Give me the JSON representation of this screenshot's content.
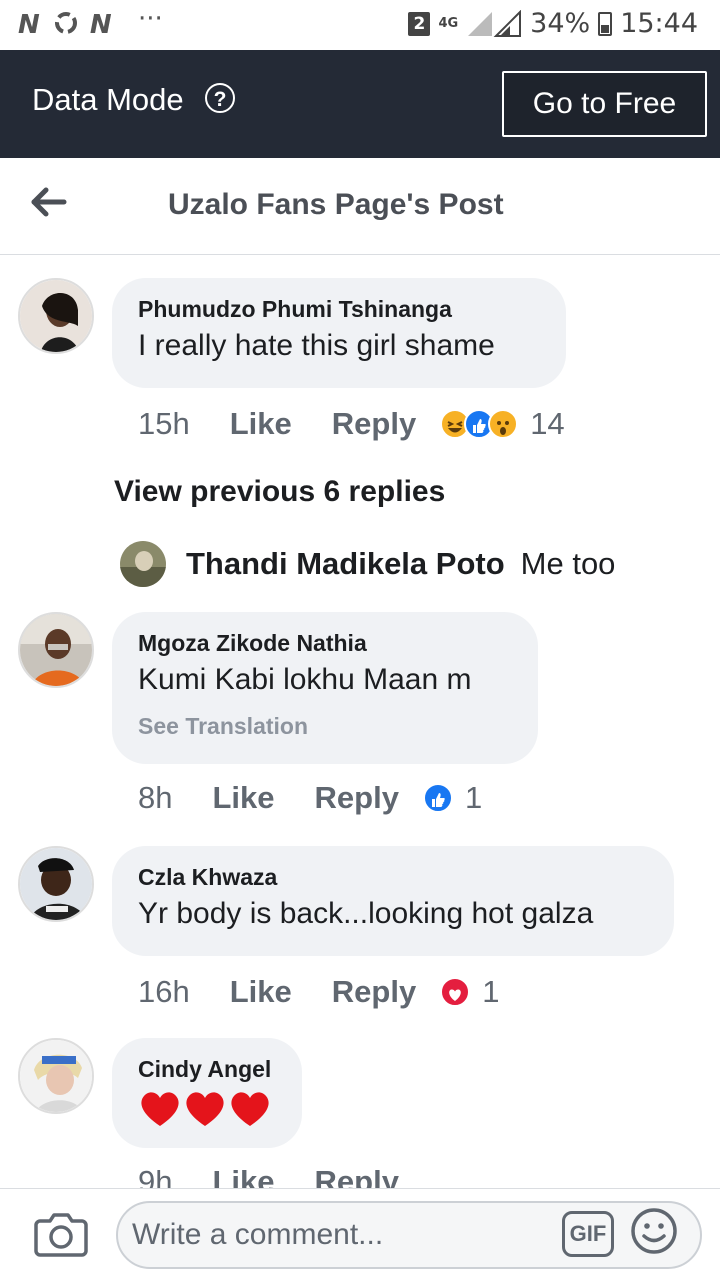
{
  "status_bar": {
    "left_icons": "N",
    "left_icons_b": "N",
    "dots": "···",
    "sim": "2",
    "network": "4G",
    "battery": "34%",
    "time": "15:44"
  },
  "data_bar": {
    "label": "Data Mode",
    "help_icon": "?",
    "go_free": "Go to Free"
  },
  "header": {
    "title": "Uzalo Fans Page's Post"
  },
  "comments": [
    {
      "author": "Phumudzo Phumi Tshinanga",
      "text": "I really hate this girl shame",
      "time": "15h",
      "like": "Like",
      "reply": "Reply",
      "reactions": [
        "haha",
        "like",
        "wow"
      ],
      "count": "14"
    },
    {
      "author": "Mgoza Zikode Nathia",
      "text": "Kumi Kabi lokhu Maan m",
      "see_translation": "See Translation",
      "time": "8h",
      "like": "Like",
      "reply": "Reply",
      "reactions": [
        "like"
      ],
      "count": "1"
    },
    {
      "author": "Czla Khwaza",
      "text": "Yr body is back...looking hot galza",
      "time": "16h",
      "like": "Like",
      "reply": "Reply",
      "reactions": [
        "love"
      ],
      "count": "1"
    },
    {
      "author": "Cindy Angel",
      "text": "❤️❤️❤️",
      "time": "9h",
      "like": "Like",
      "reply": "Reply"
    }
  ],
  "view_previous": "View previous 6 replies",
  "reply_preview": {
    "author": "Thandi Madikela Poto",
    "text": "Me too"
  },
  "composer": {
    "placeholder": "Write a comment...",
    "gif": "GIF"
  },
  "colors": {
    "data_bar_bg": "#242a36",
    "bubble_bg": "#f0f2f5",
    "like_blue": "#1877f2",
    "love_red": "#e41e3f"
  }
}
